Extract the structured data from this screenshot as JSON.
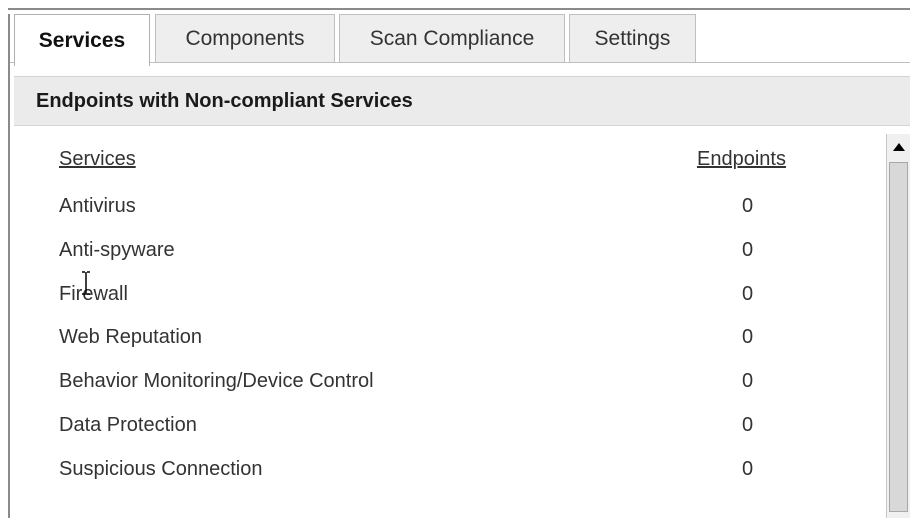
{
  "tabs": [
    {
      "label": "Services",
      "active": true
    },
    {
      "label": "Components",
      "active": false
    },
    {
      "label": "Scan Compliance",
      "active": false
    },
    {
      "label": "Settings",
      "active": false
    }
  ],
  "section": {
    "title": "Endpoints with Non-compliant Services"
  },
  "table": {
    "headers": {
      "services": "Services",
      "endpoints": "Endpoints"
    },
    "rows": [
      {
        "service": "Antivirus",
        "endpoints": "0"
      },
      {
        "service": "Anti-spyware",
        "endpoints": "0"
      },
      {
        "service": "Firewall",
        "endpoints": "0"
      },
      {
        "service": "Web Reputation",
        "endpoints": "0"
      },
      {
        "service": "Behavior Monitoring/Device Control",
        "endpoints": "0"
      },
      {
        "service": "Data Protection",
        "endpoints": "0"
      },
      {
        "service": "Suspicious Connection",
        "endpoints": "0"
      }
    ]
  },
  "scrollbar": {
    "up_arrow_icon": "triangle-up-icon"
  },
  "cursor": {
    "icon": "text-cursor-icon"
  }
}
